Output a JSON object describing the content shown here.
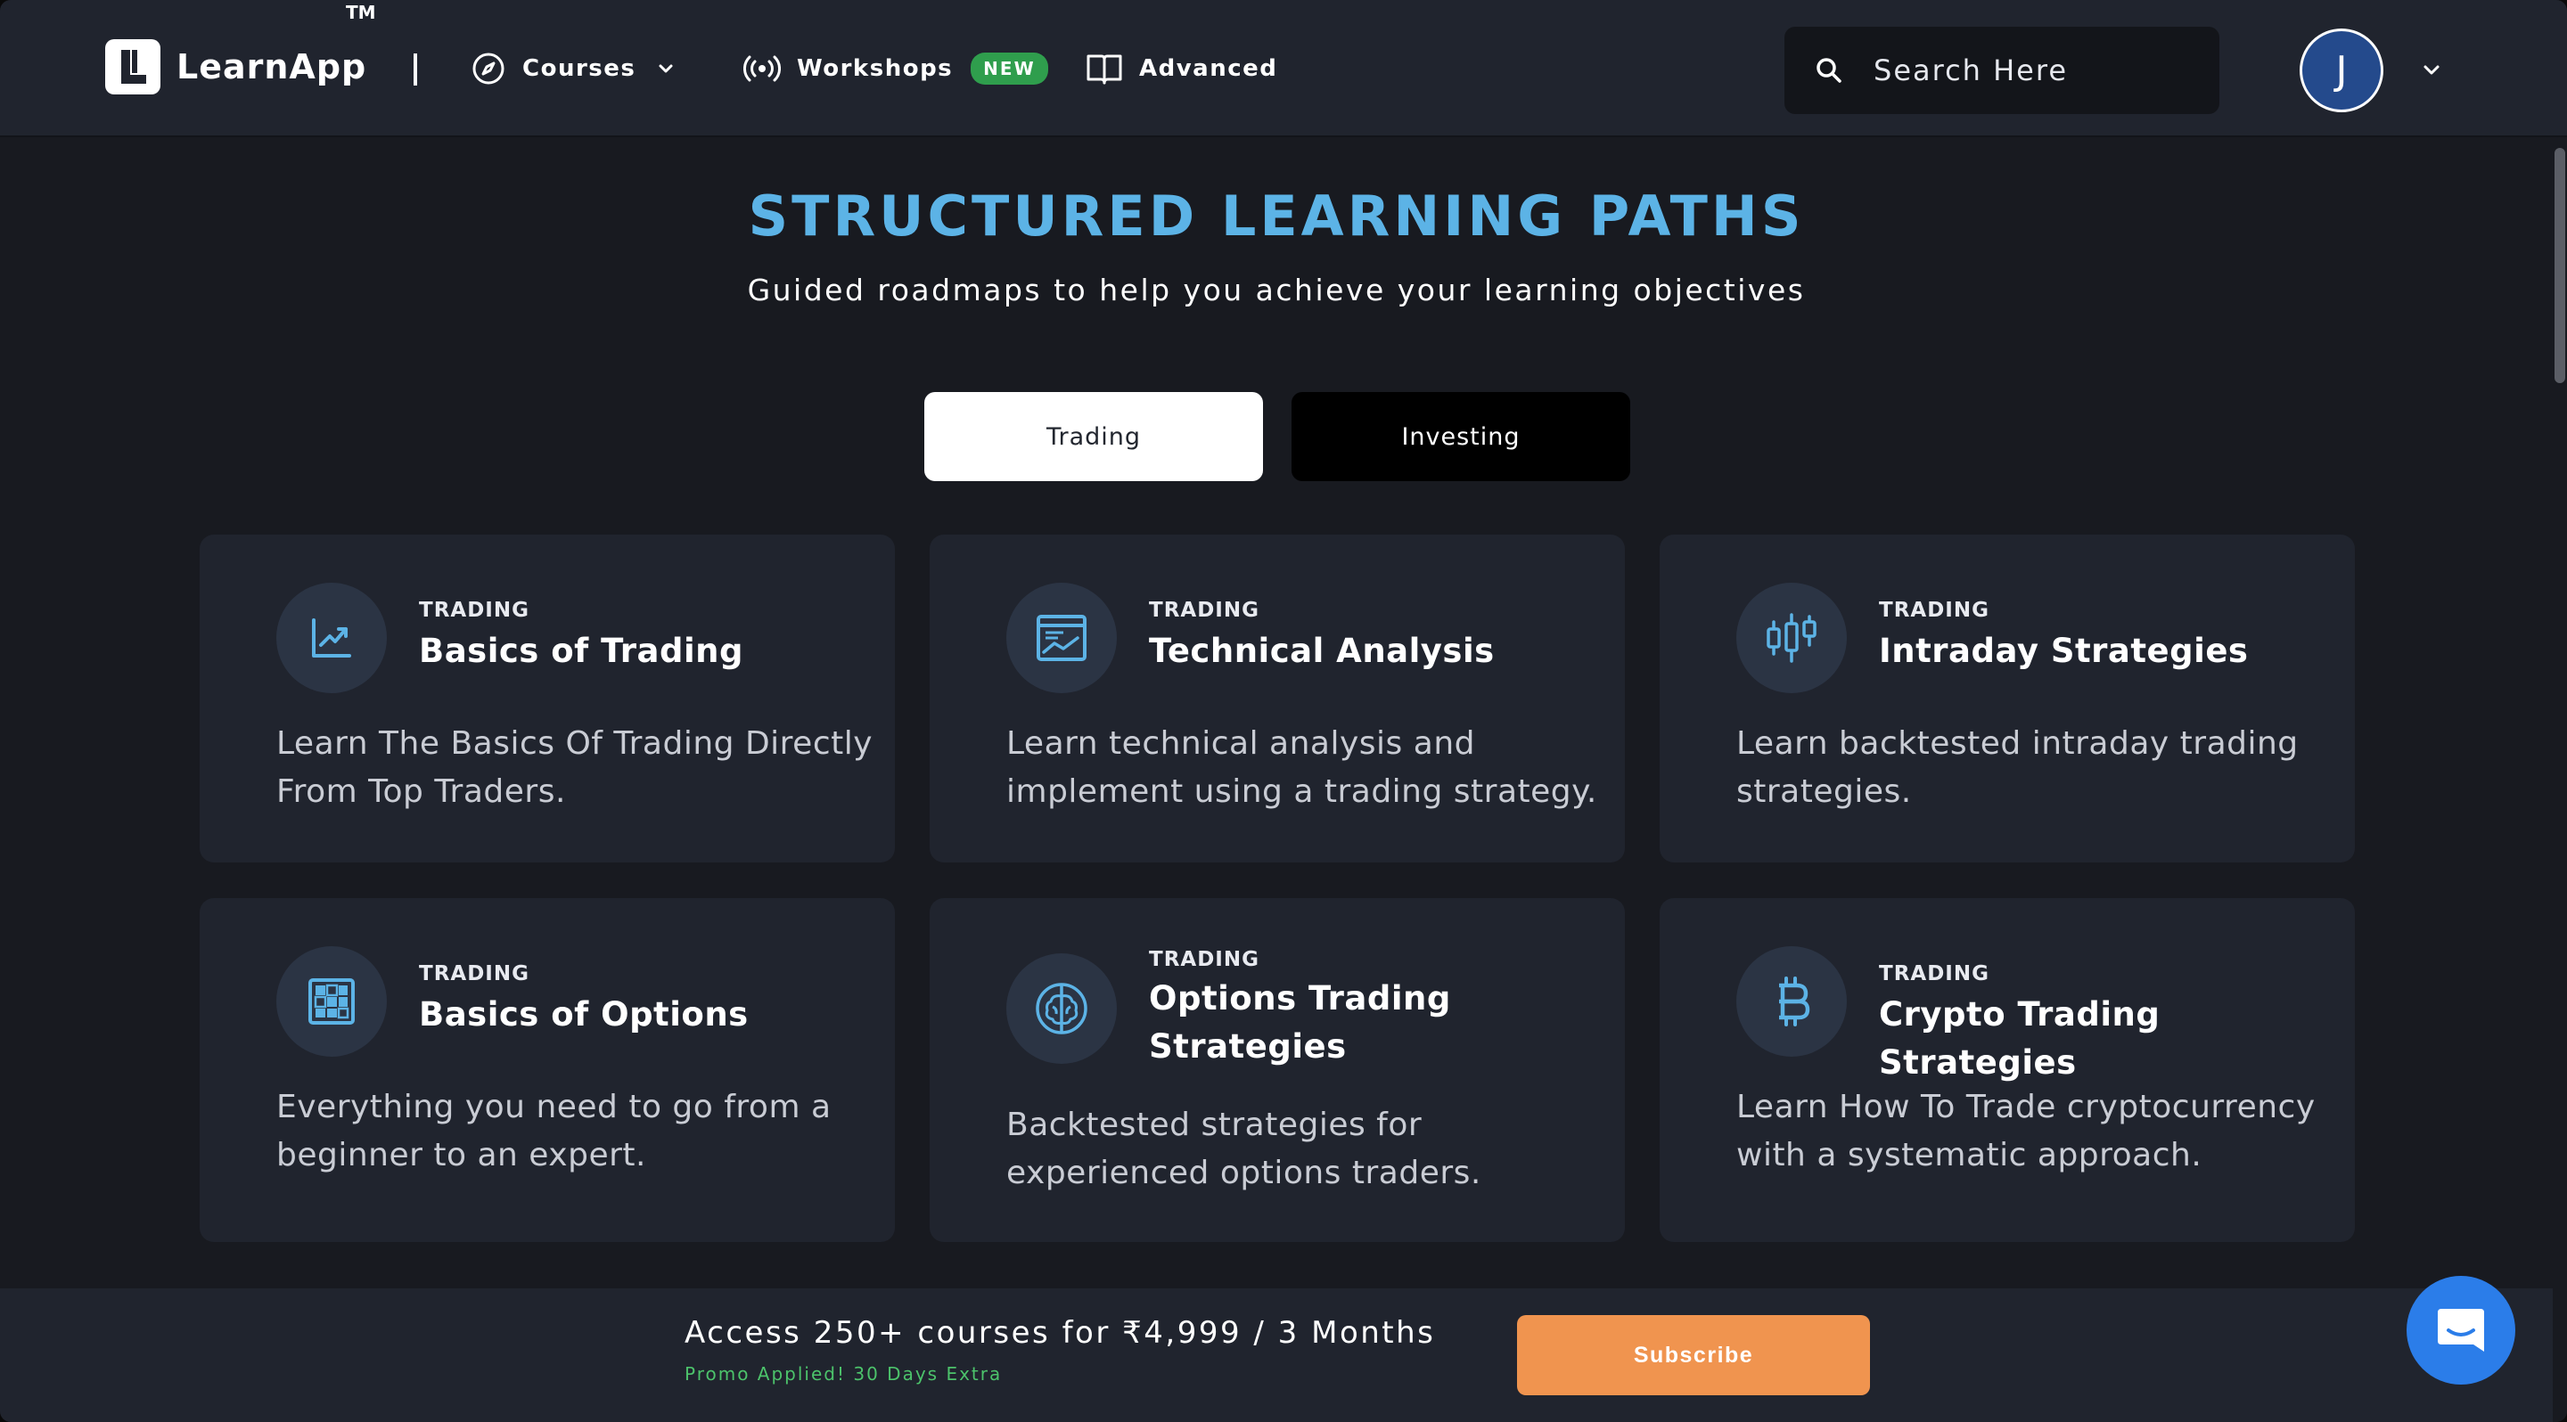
{
  "brand": {
    "name": "LearnApp",
    "tm": "TM"
  },
  "nav": {
    "courses": "Courses",
    "workshops": "Workshops",
    "workshops_badge": "NEW",
    "advanced": "Advanced"
  },
  "search": {
    "placeholder": "Search Here"
  },
  "user": {
    "initial": "J"
  },
  "hero": {
    "title": "STRUCTURED LEARNING PATHS",
    "subtitle": "Guided roadmaps to help you achieve your learning objectives"
  },
  "tabs": [
    {
      "label": "Trading",
      "active": true
    },
    {
      "label": "Investing",
      "active": false
    }
  ],
  "cards": [
    {
      "tag": "TRADING",
      "title": "Basics of Trading",
      "desc": "Learn The Basics Of Trading Directly From Top Traders.",
      "icon": "line-chart-icon"
    },
    {
      "tag": "TRADING",
      "title": "Technical Analysis",
      "desc": "Learn technical analysis and implement using a trading strategy.",
      "icon": "chart-window-icon"
    },
    {
      "tag": "TRADING",
      "title": "Intraday Strategies",
      "desc": "Learn backtested intraday trading strategies.",
      "icon": "candlestick-icon"
    },
    {
      "tag": "TRADING",
      "title": "Basics of Options",
      "desc": "Everything you need to go from a beginner to an expert.",
      "icon": "grid-icon"
    },
    {
      "tag": "TRADING",
      "title": "Options Trading Strategies",
      "desc": "Backtested strategies for experienced options traders.",
      "icon": "brain-icon"
    },
    {
      "tag": "TRADING",
      "title": "Crypto Trading Strategies",
      "desc": "Learn How To Trade cryptocurrency with a systematic approach.",
      "icon": "bitcoin-icon"
    }
  ],
  "promo": {
    "main": "Access 250+ courses for ₹4,999 / 3 Months",
    "note": "Promo Applied! 30 Days Extra",
    "button": "Subscribe"
  },
  "colors": {
    "accent": "#5cb3e6",
    "subscribe": "#f0944f",
    "badge": "#2f9e4d",
    "chat": "#2b7de9"
  }
}
